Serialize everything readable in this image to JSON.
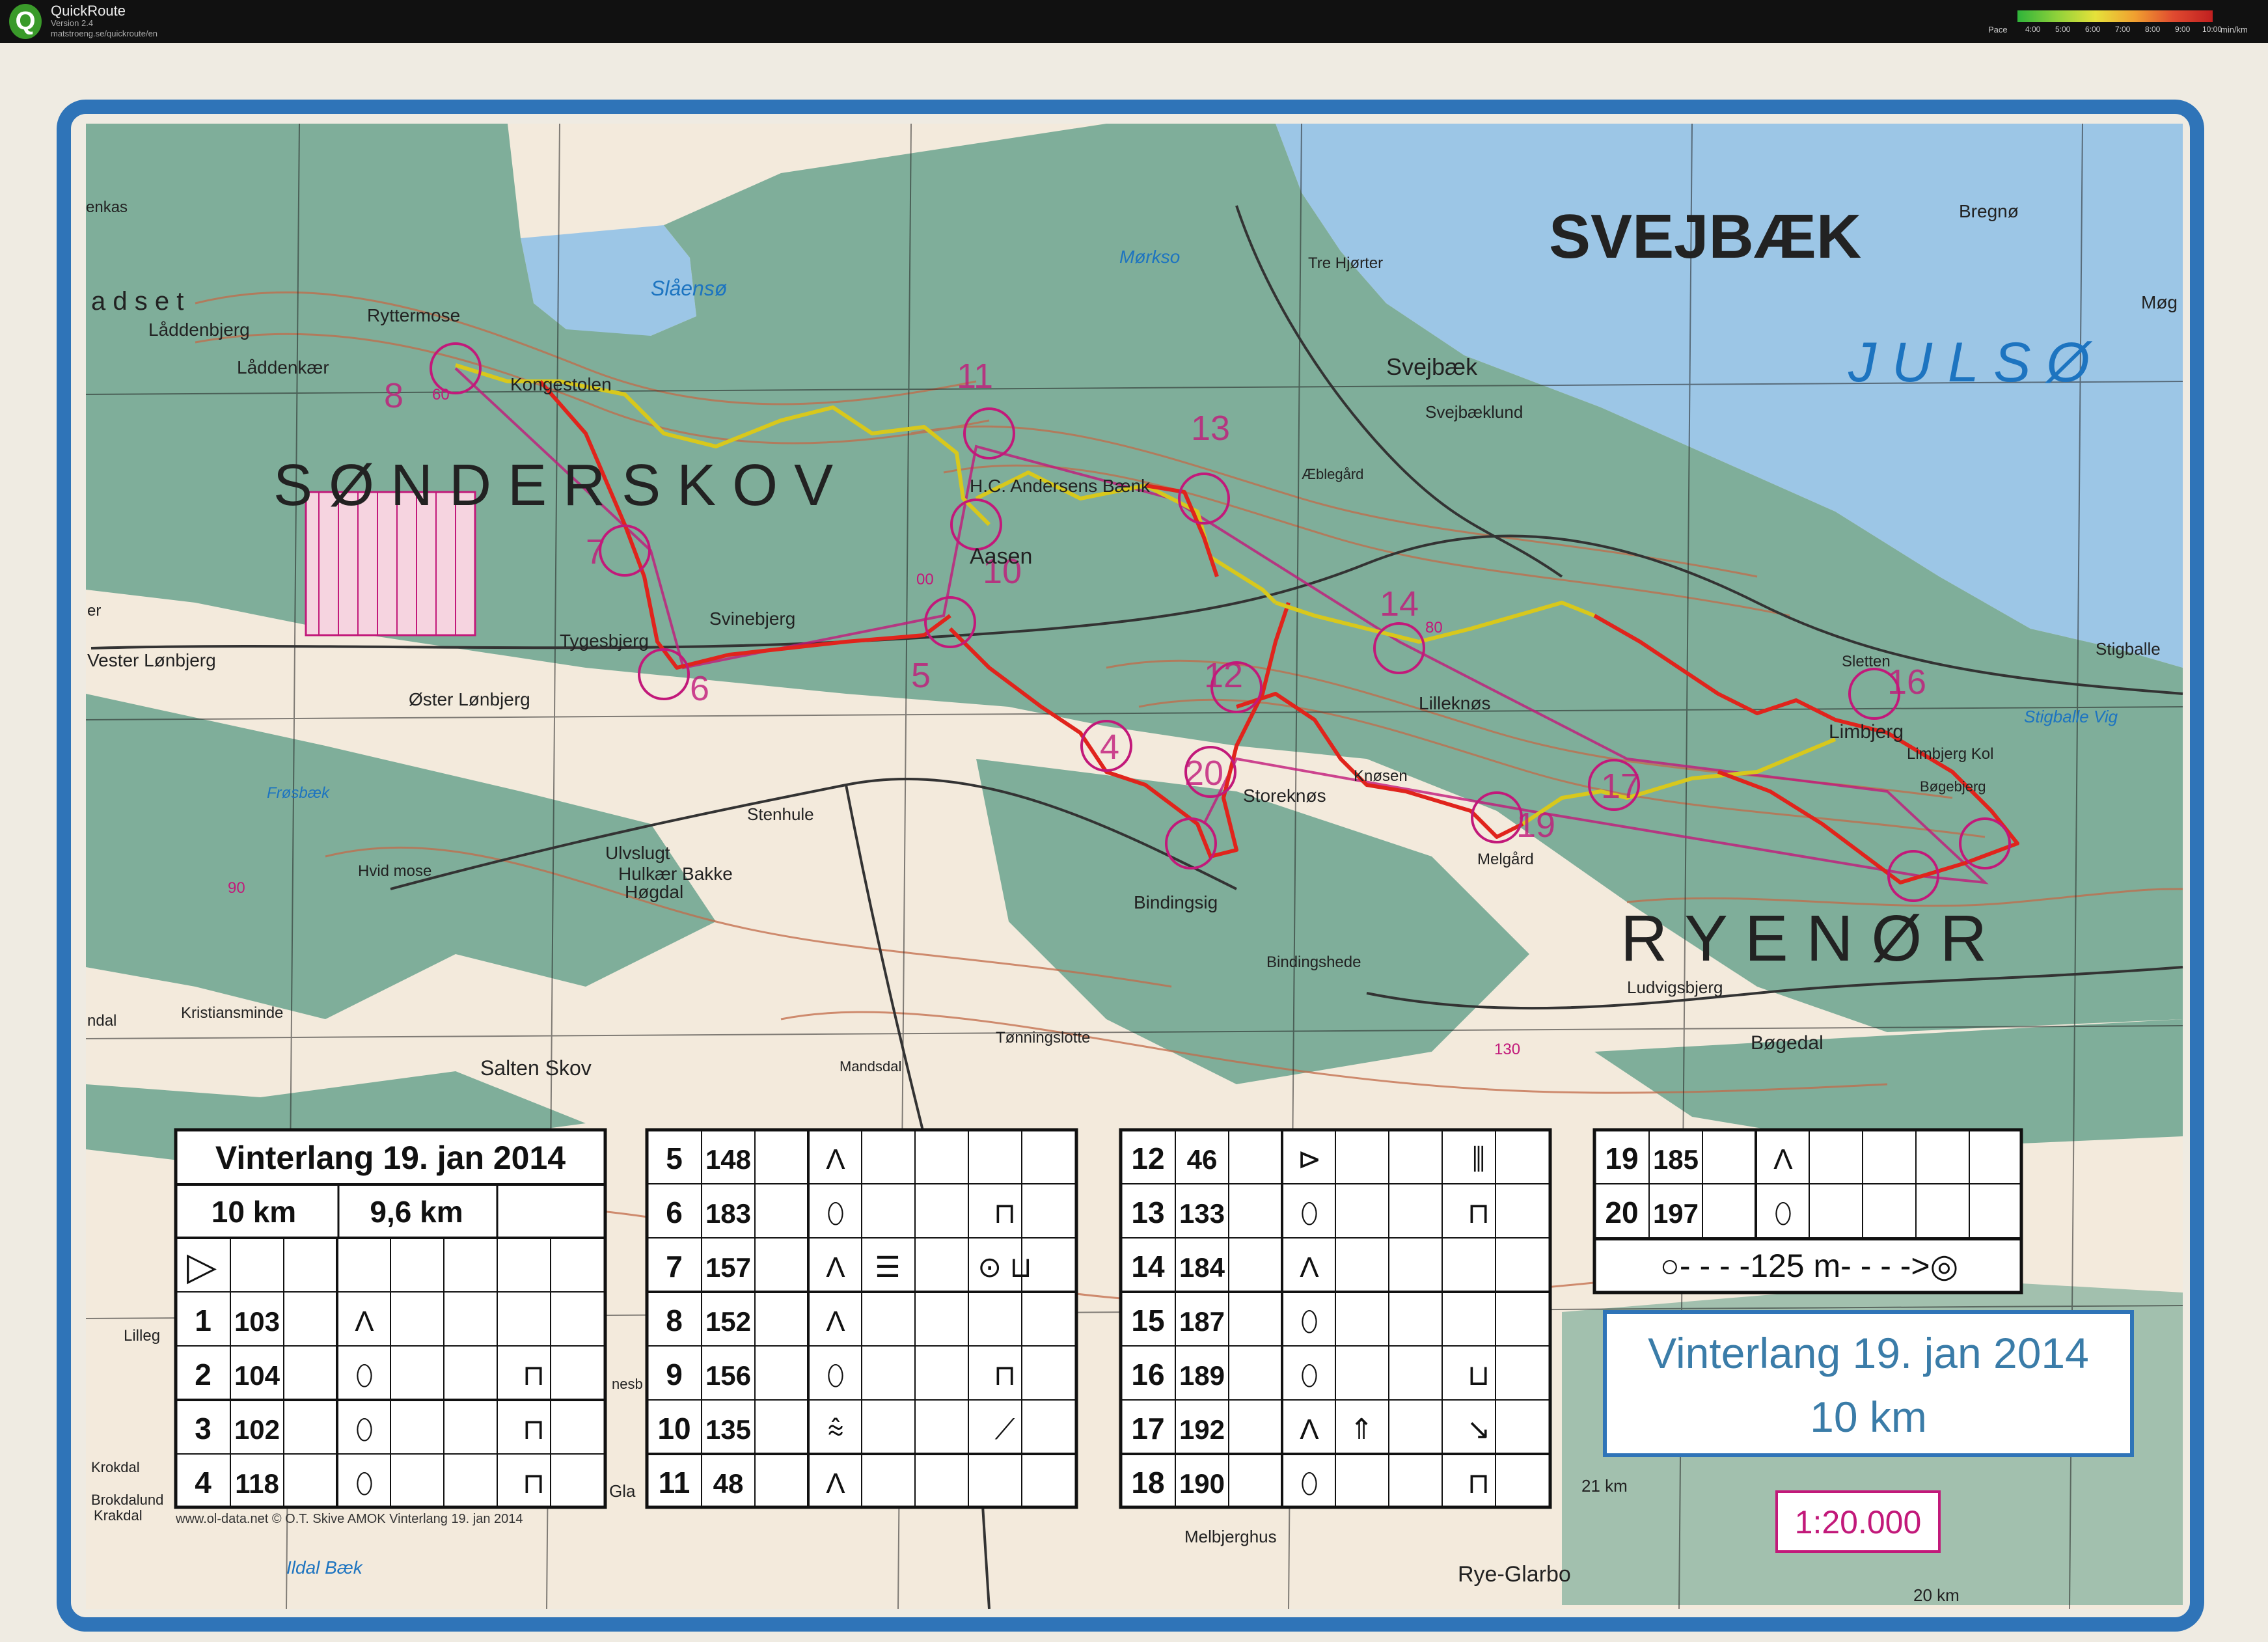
{
  "app": {
    "name": "QuickRoute",
    "version": "Version 2.4",
    "url": "matstroeng.se/quickroute/en",
    "logo_letter": "Q"
  },
  "pace_scale": {
    "label": "Pace",
    "ticks": [
      "4:00",
      "5:00",
      "6:00",
      "7:00",
      "8:00",
      "9:00",
      "10:00"
    ],
    "unit": "min/km"
  },
  "colors": {
    "frame": "#2f74b8",
    "water": "#9cc6e6",
    "forest": "#7fae9a",
    "open": "#f3eadc",
    "course": "#c2197a",
    "route_red": "#e0241c",
    "route_yellow": "#d8c81c"
  },
  "map": {
    "title_labels": {
      "svejbaek_big": "SVEJBÆK",
      "julso": "J U L S Ø",
      "sonderskov": "S Ø N D E R S K O V",
      "rye_nor": "R Y E   N Ø R",
      "radset": "a d s e t"
    },
    "place_labels": [
      "Bregnø",
      "Møg",
      "Tre Hjørter",
      "Mørkso",
      "Slåensø",
      "Ryttermose",
      "Låddenbjerg",
      "Låddenkær",
      "Kongestolen",
      "H.C. Andersens Bænk",
      "Æblegård",
      "Svejbæk",
      "Svejbæklund",
      "Svinebjerg",
      "Tygesbjerg",
      "Vester Lønbjerg",
      "Øster Lønbjerg",
      "Lilleknøs",
      "Sletten",
      "Stigballe",
      "Stigballe Vig",
      "Limbjerg",
      "Limbjerg Kol",
      "Bøgebjerg",
      "Storeknøs",
      "Knøsen",
      "Melgård",
      "Stenhule",
      "Ulvslugt",
      "Hulkær Bakke",
      "Høgdal",
      "Hvid mose",
      "Bindingsig",
      "Bindingshede",
      "Ludvigsbjerg",
      "Kristiansminde",
      "Salten Skov",
      "Tønningslotte",
      "Mandsdal",
      "Bøgedal",
      "Melbjerghus",
      "Rye-Glarbo",
      "Ildal Bæk",
      "Frøsbæk",
      "Aasen",
      "Gla",
      "nesb",
      "enkas",
      "ndal",
      "er",
      "Lilleg",
      "Krokdal",
      "Brokdalund",
      "Krakdal"
    ],
    "spot_heights": [
      "60",
      "90",
      "130",
      "80",
      "00"
    ],
    "scale_text": "1:20.000",
    "km_labels": [
      "21 km",
      "20 km"
    ],
    "credit": "www.ol-data.net © O.T. Skive AMOK Vinterlang 19. jan 2014",
    "control_numbers_on_map": [
      "8",
      "11",
      "13",
      "7",
      "10",
      "14",
      "6",
      "5",
      "12",
      "16",
      "4",
      "20",
      "19",
      "17"
    ]
  },
  "control_card": {
    "title": "Vinterlang 19. jan 2014",
    "distance_1": "10 km",
    "distance_2": "9,6 km",
    "start_symbol": "▷",
    "rows": [
      {
        "n": "1",
        "code": "103",
        "feature": "Ʌ",
        "extra": "",
        "pos": ""
      },
      {
        "n": "2",
        "code": "104",
        "feature": "⬯",
        "extra": "",
        "pos": "⊓"
      },
      {
        "n": "3",
        "code": "102",
        "feature": "⬯",
        "extra": "",
        "pos": "⊓"
      },
      {
        "n": "4",
        "code": "118",
        "feature": "⬯",
        "extra": "",
        "pos": "⊓"
      },
      {
        "n": "5",
        "code": "148",
        "feature": "Ʌ",
        "extra": "",
        "pos": ""
      },
      {
        "n": "6",
        "code": "183",
        "feature": "⬯",
        "extra": "",
        "pos": "⊓"
      },
      {
        "n": "7",
        "code": "157",
        "feature": "Ʌ",
        "extra": "☰",
        "pos": "⊙ ⊔"
      },
      {
        "n": "8",
        "code": "152",
        "feature": "Ʌ",
        "extra": "",
        "pos": ""
      },
      {
        "n": "9",
        "code": "156",
        "feature": "⬯",
        "extra": "",
        "pos": "⊓"
      },
      {
        "n": "10",
        "code": "135",
        "feature": "⩯",
        "extra": "",
        "pos": "⟋"
      },
      {
        "n": "11",
        "code": "48",
        "feature": "Ʌ",
        "extra": "",
        "pos": ""
      },
      {
        "n": "12",
        "code": "46",
        "feature": "⊳",
        "extra": "",
        "pos": "⫼"
      },
      {
        "n": "13",
        "code": "133",
        "feature": "⬯",
        "extra": "",
        "pos": "⊓"
      },
      {
        "n": "14",
        "code": "184",
        "feature": "Ʌ",
        "extra": "",
        "pos": ""
      },
      {
        "n": "15",
        "code": "187",
        "feature": "⬯",
        "extra": "",
        "pos": ""
      },
      {
        "n": "16",
        "code": "189",
        "feature": "⬯",
        "extra": "",
        "pos": "⊔"
      },
      {
        "n": "17",
        "code": "192",
        "feature": "Ʌ",
        "extra": "⇑",
        "pos": "↘"
      },
      {
        "n": "18",
        "code": "190",
        "feature": "⬯",
        "extra": "",
        "pos": "⊓"
      },
      {
        "n": "19",
        "code": "185",
        "feature": "Ʌ",
        "extra": "",
        "pos": ""
      },
      {
        "n": "20",
        "code": "197",
        "feature": "⬯",
        "extra": "",
        "pos": ""
      }
    ],
    "finish": "○- - - -125 m- - - ->◎"
  },
  "event_box": {
    "line1": "Vinterlang 19. jan 2014",
    "line2": "10 km"
  }
}
